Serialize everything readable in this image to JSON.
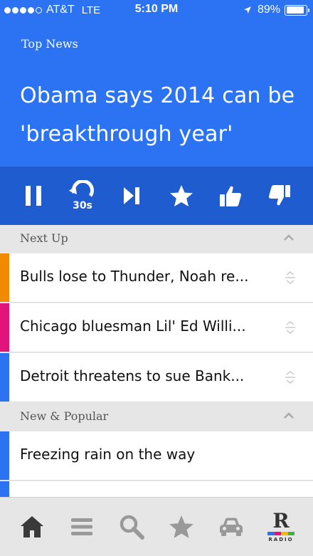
{
  "status_bar": {
    "carrier": "AT&T",
    "network": "LTE",
    "time": "5:10 PM",
    "battery": "89%",
    "battery_level": 0.89,
    "signal_bars": 4
  },
  "header": {
    "section": "Top News",
    "headline": "Obama says 2014 can be 'breakthrough year'"
  },
  "controls": {
    "pause": "pause-icon",
    "rewind": "rewind-30-icon",
    "rewind_label": "30s",
    "skip": "skip-icon",
    "favorite": "star-icon",
    "like": "thumbs-up-icon",
    "dislike": "thumbs-down-icon"
  },
  "next_up": {
    "label": "Next Up",
    "items": [
      {
        "title": "Bulls lose to Thunder, Noah re...",
        "color": "#f28a00"
      },
      {
        "title": "Chicago bluesman Lil' Ed Willi...",
        "color": "#e2137a"
      },
      {
        "title": "Detroit threatens to sue Bank...",
        "color": "#2b73f2"
      }
    ]
  },
  "new_popular": {
    "label": "New & Popular",
    "items": [
      {
        "title": "Freezing rain on the way",
        "color": "#2b73f2"
      }
    ]
  },
  "tabbar": {
    "tabs": [
      "home-icon",
      "menu-icon",
      "search-icon",
      "favorites-icon",
      "car-icon",
      "radio-logo"
    ],
    "radio_letter": "R",
    "radio_word": "RADIO",
    "radio_stripe_colors": [
      "#2b73f2",
      "#e2137a",
      "#f5b800",
      "#38b54a"
    ]
  },
  "colors": {
    "accent": "#2b73f2",
    "controls_bg": "#1e5cd0"
  }
}
